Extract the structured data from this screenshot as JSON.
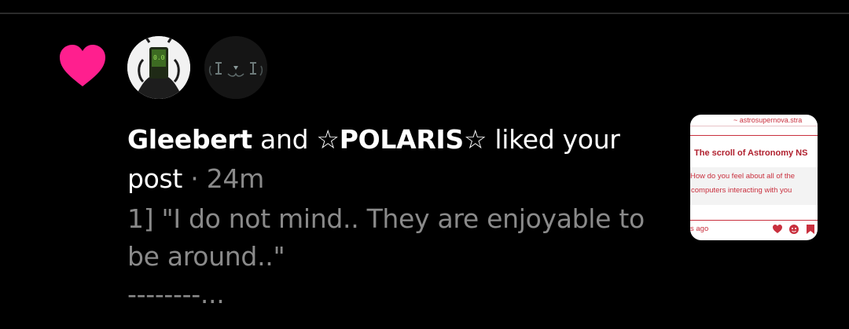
{
  "notification": {
    "actor_1": "Gleebert",
    "conjunction": "and",
    "actor_2": "☆POLARIS☆",
    "action": "liked your",
    "object": "post",
    "separator": "·",
    "time": "24m",
    "preview_line_1": "1] \"I do not mind.. They are enjoyable to",
    "preview_line_2": "be around..\"",
    "preview_line_3": "--------..."
  },
  "thumbnail": {
    "blog_name": "~ astrosupernova.stra",
    "title": "The scroll of Astronomy NS",
    "body_line_1": "How do you feel about all of the",
    "body_line_2": "computers interacting with you",
    "ago": "s ago",
    "icons": [
      "heart-icon",
      "reblog-icon",
      "bookmark-icon"
    ]
  },
  "colors": {
    "heart": "#ff1f8e",
    "text": "#ffffff",
    "muted": "#8a8a8a",
    "thumb_accent": "#c9303e"
  }
}
